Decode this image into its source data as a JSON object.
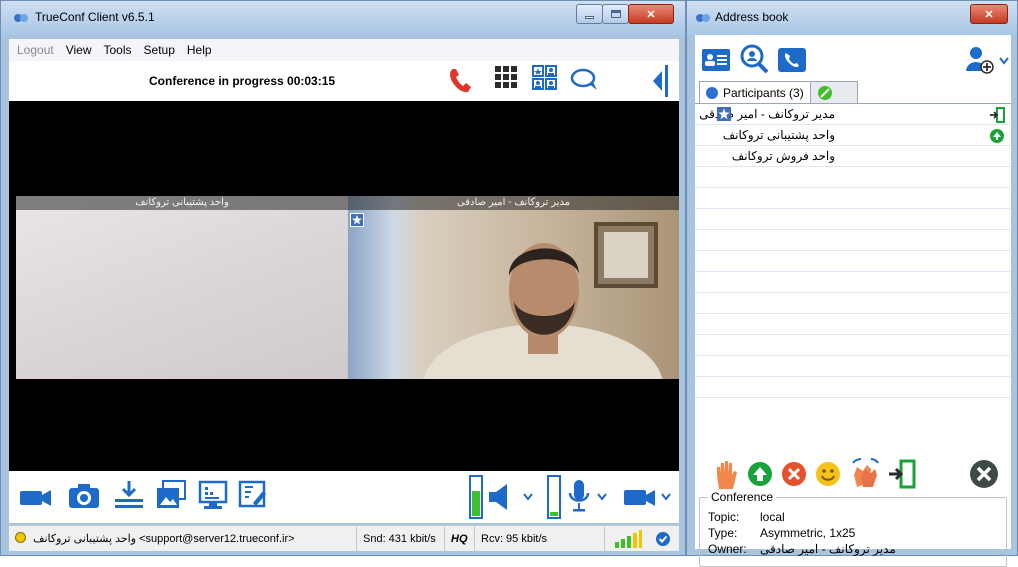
{
  "main_window": {
    "title": "TrueConf Client v6.5.1",
    "menu": [
      "Logout",
      "View",
      "Tools",
      "Setup",
      "Help"
    ],
    "conference_status": "Conference in progress 00:03:15",
    "tiles": [
      {
        "caption": "واحد پشتیبانی تروکانف"
      },
      {
        "caption": "مدیر تروکانف - امیر صادقی"
      }
    ],
    "status_bar": {
      "contact": "واحد پشتیبانی تروکانف <support@server12.trueconf.ir>",
      "send": "Snd: 431 kbit/s",
      "quality": "HQ",
      "receive": "Rcv: 95 kbit/s"
    }
  },
  "address_book": {
    "title": "Address book",
    "tabs": {
      "participants": "Participants (3)"
    },
    "participants": [
      {
        "name": "مدیر تروکانف - امیر صادقی",
        "owner": true
      },
      {
        "name": "واحد پشتیبانی تروکانف",
        "owner": false
      },
      {
        "name": "واحد فروش تروکانف",
        "owner": false
      }
    ],
    "conference": {
      "legend": "Conference",
      "topic_label": "Topic:",
      "topic": "local",
      "type_label": "Type:",
      "type": "Asymmetric, 1x25",
      "owner_label": "Owner:",
      "owner": "مدیر تروکانف - امیر صادقی"
    }
  },
  "colors": {
    "accent_blue": "#1e6ac8",
    "hangup_red": "#e0352b",
    "level_green": "#3fbf2e",
    "button_green": "#1aa23a",
    "button_red": "#e5502d",
    "dark_close": "#3d4a45",
    "frame_blue": "#a9c4df"
  }
}
